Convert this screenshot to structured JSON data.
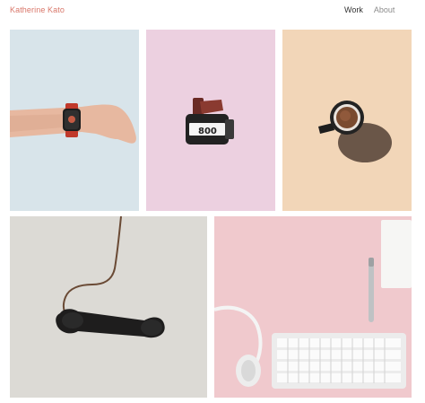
{
  "site": {
    "title": "Katherine Kato",
    "title_color": "#d9776a"
  },
  "nav": {
    "items": [
      {
        "label": "Work",
        "active": true
      },
      {
        "label": "About",
        "active": false
      }
    ]
  },
  "gallery": {
    "tiles": [
      {
        "name": "smartwatch-photo",
        "subject": "wrist-with-smartwatch",
        "background": "#d8e4ea"
      },
      {
        "name": "film-canister-photo",
        "subject": "film-canister",
        "background": "#ecd0e0",
        "label_text": "800"
      },
      {
        "name": "coffee-cup-photo",
        "subject": "coffee-cup",
        "background": "#f2d6b8"
      },
      {
        "name": "telephone-handset-photo",
        "subject": "telephone-handset",
        "background": "#dcdad5"
      },
      {
        "name": "desk-setup-photo",
        "subject": "keyboard-headphones-notebook-pen",
        "background": "#f0c9cd"
      }
    ]
  }
}
